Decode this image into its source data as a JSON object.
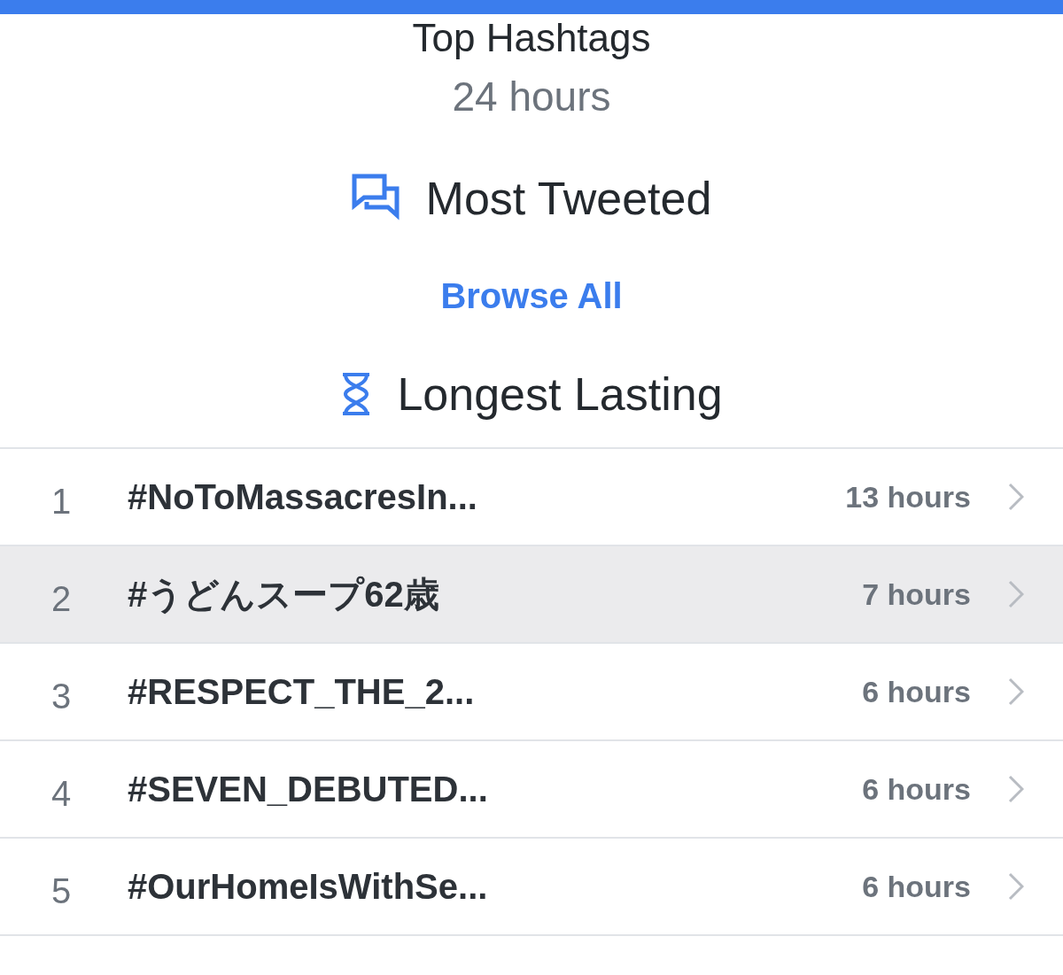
{
  "header": {
    "title": "Top Hashtags",
    "period": "24 hours"
  },
  "sections": [
    {
      "kind": "tweeted",
      "title": "Most Tweeted"
    },
    {
      "kind": "link",
      "title": "Browse All"
    },
    {
      "kind": "lasting",
      "title": "Longest Lasting"
    }
  ],
  "rows": [
    {
      "rank": "1",
      "hashtag": "#NoToMassacresIn...",
      "duration": "13 hours",
      "selected": false
    },
    {
      "rank": "2",
      "hashtag": "#うどんスープ62歳",
      "duration": "7 hours",
      "selected": true
    },
    {
      "rank": "3",
      "hashtag": "#RESPECT_THE_2...",
      "duration": "6 hours",
      "selected": false
    },
    {
      "rank": "4",
      "hashtag": "#SEVEN_DEBUTED...",
      "duration": "6 hours",
      "selected": false
    },
    {
      "rank": "5",
      "hashtag": "#OurHomeIsWithSe...",
      "duration": "6 hours",
      "selected": false
    }
  ]
}
